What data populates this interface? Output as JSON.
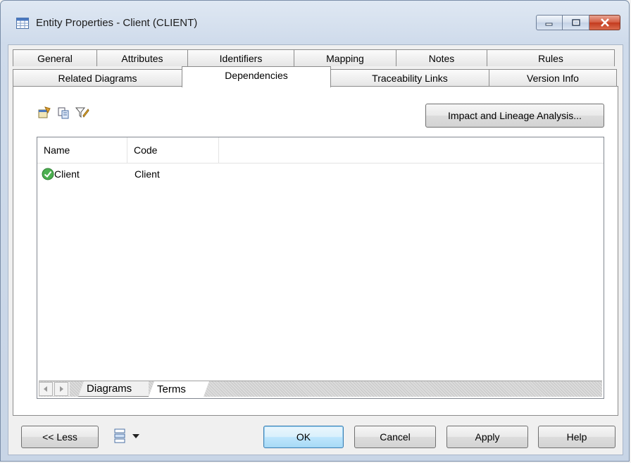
{
  "window": {
    "title": "Entity Properties - Client (CLIENT)"
  },
  "tabs": {
    "row1": [
      "General",
      "Attributes",
      "Identifiers",
      "Mapping",
      "Notes",
      "Rules"
    ],
    "row2": [
      "Related Diagrams",
      "Dependencies",
      "Traceability Links",
      "Version Info"
    ],
    "active": "Dependencies"
  },
  "toolbar": {
    "impact_button": "Impact and Lineage Analysis..."
  },
  "list": {
    "columns": [
      "Name",
      "Code"
    ],
    "rows": [
      {
        "name": "Client",
        "code": "Client"
      }
    ]
  },
  "subtabs": {
    "items": [
      "Diagrams",
      "Terms"
    ],
    "active": "Terms"
  },
  "footer": {
    "less_button": "<< Less",
    "ok_button": "OK",
    "cancel_button": "Cancel",
    "apply_button": "Apply",
    "help_button": "Help"
  }
}
